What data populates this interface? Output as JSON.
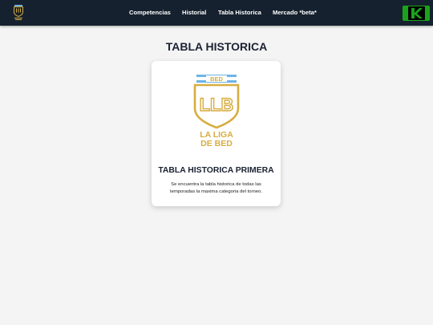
{
  "nav": {
    "logo_icon": "la-liga-de-bed-logo",
    "links": [
      {
        "label": "Competencias"
      },
      {
        "label": "Historial"
      },
      {
        "label": "Tabla Historica"
      },
      {
        "label": "Mercado *beta*"
      }
    ],
    "kick_icon": "kick-logo-icon"
  },
  "page": {
    "title": "TABLA HISTORICA"
  },
  "card": {
    "logo": {
      "banner": "BED",
      "monogram": "LLB",
      "line1": "LA LIGA",
      "line2": "DE BED"
    },
    "title": "TABLA HISTORICA PRIMERA",
    "description": "Se encuentra la tabla historica de todas las temporadas la maxima categoria del torneo."
  },
  "colors": {
    "navbar_bg": "#16212f",
    "page_bg": "#f4f4f4",
    "gold": "#d8ad40",
    "sky_blue": "#6db4e6",
    "kick_green": "#1aa31a"
  }
}
